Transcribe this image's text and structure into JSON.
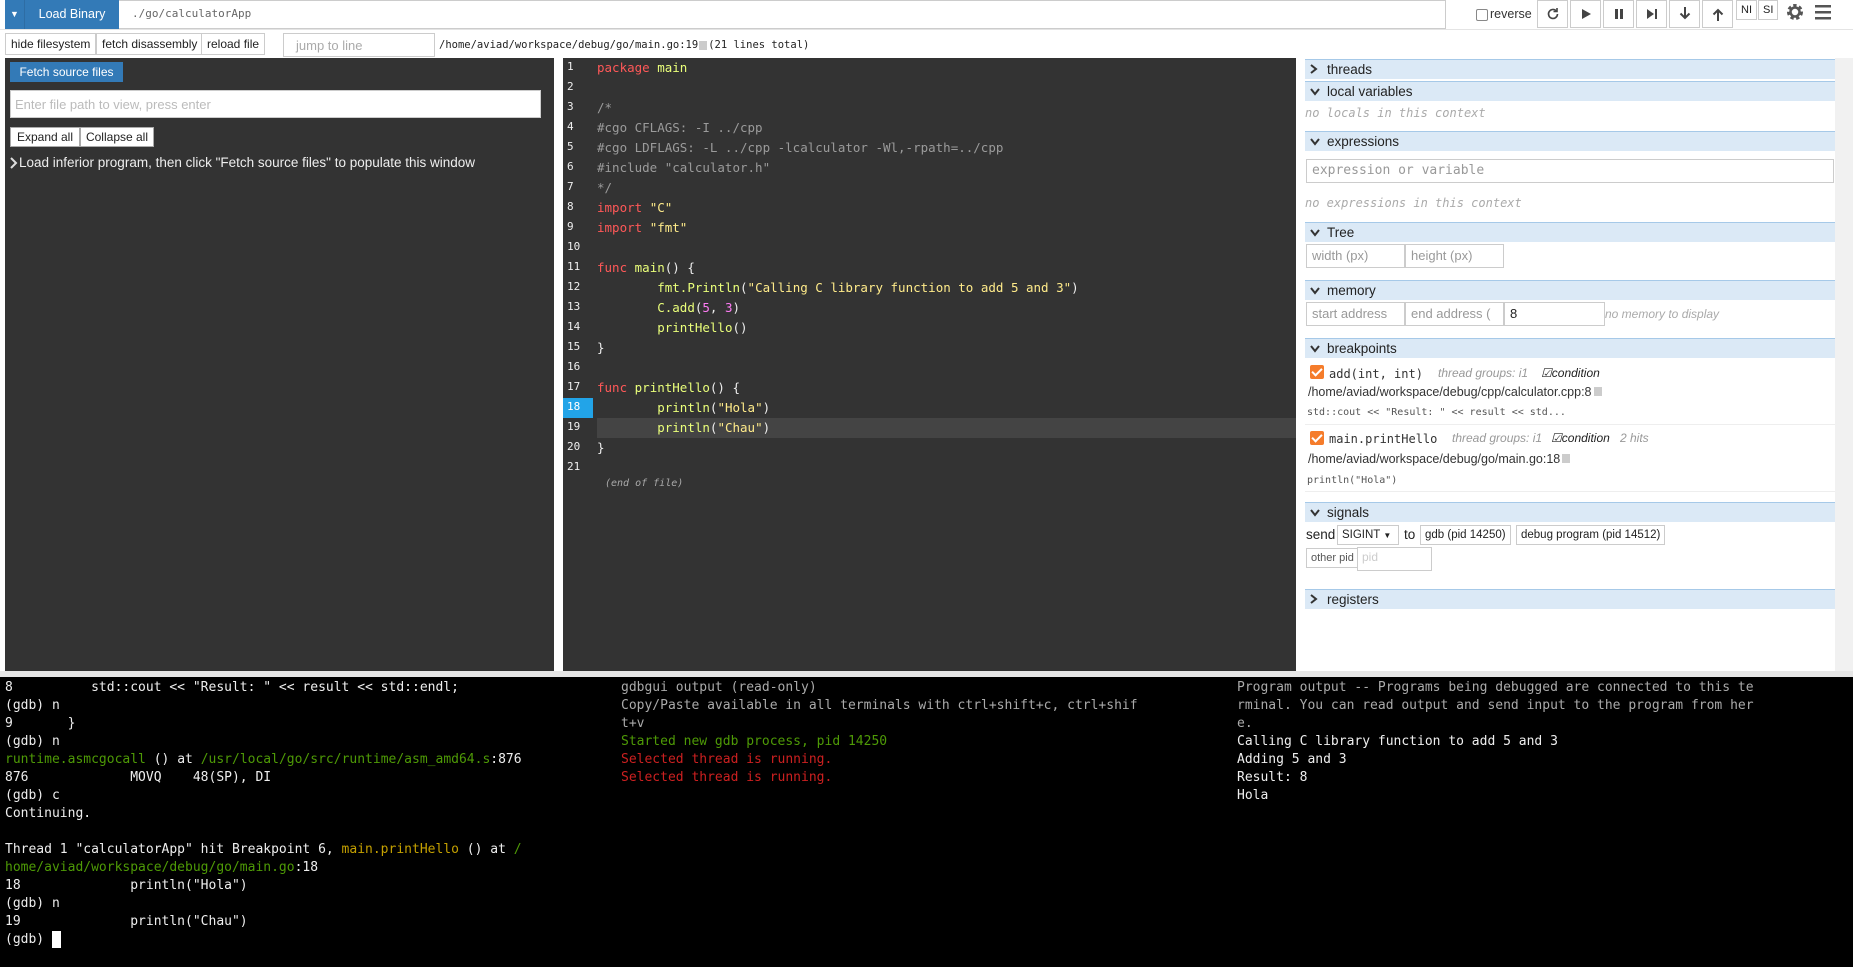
{
  "toolbar": {
    "load_binary_label": "Load Binary",
    "binary_path": "./go/calculatorApp",
    "reverse_label": "reverse",
    "ni_label": "NI",
    "si_label": "SI"
  },
  "subbar": {
    "hide_fs_label": "hide filesystem",
    "fetch_disasm_label": "fetch disassembly",
    "reload_label": "reload file",
    "jump_placeholder": "jump to line",
    "file_path": "/home/aviad/workspace/debug/go/main.go:19",
    "lines_total": "(21 lines total)"
  },
  "filesystem": {
    "fetch_label": "Fetch source files",
    "path_placeholder": "Enter file path to view, press enter",
    "expand_label": "Expand all",
    "collapse_label": "Collapse all",
    "message": "Load inferior program, then click \"Fetch source files\" to populate this window"
  },
  "source": {
    "current_line": 18,
    "highlight_line": 19,
    "eof_label": "(end of file)",
    "line_numbers": [
      "1",
      "2",
      "3",
      "4",
      "5",
      "6",
      "7",
      "8",
      "9",
      "10",
      "11",
      "12",
      "13",
      "14",
      "15",
      "16",
      "17",
      "18",
      "19",
      "20",
      "21"
    ]
  },
  "sidebar": {
    "threads_title": "threads",
    "locals_title": "local variables",
    "locals_empty": "no locals in this context",
    "expressions_title": "expressions",
    "expr_placeholder": "expression or variable",
    "expr_empty": "no expressions in this context",
    "tree_title": "Tree",
    "tree_width_ph": "width (px)",
    "tree_height_ph": "height (px)",
    "memory_title": "memory",
    "mem_start_ph": "start address",
    "mem_end_ph": "end address (",
    "mem_count": "8",
    "mem_empty": "no memory to display",
    "breakpoints_title": "breakpoints",
    "breakpoints": [
      {
        "fn": "add(int, int)",
        "meta": "thread groups: i1",
        "cond": "condition",
        "hits": "",
        "path": "/home/aviad/workspace/debug/cpp/calculator.cpp:8",
        "src": "std::cout << \"Result: \" << result << std..."
      },
      {
        "fn": "main.printHello",
        "meta": "thread groups: i1",
        "cond": "condition",
        "hits": "2 hits",
        "path": "/home/aviad/workspace/debug/go/main.go:18",
        "src": "println(\"Hola\")"
      }
    ],
    "signals_title": "signals",
    "send_label": "send",
    "signal_value": "SIGINT",
    "to_label": "to",
    "gdb_pid_label": "gdb (pid 14250)",
    "debug_pid_label": "debug program (pid 14512)",
    "other_pid_label": "other pid",
    "pid_placeholder": "pid",
    "registers_title": "registers"
  },
  "terminals": {
    "gdb": {
      "l1": "8          std::cout << \"Result: \" << result << std::endl;",
      "l2": "(gdb) n",
      "l3": "9       }",
      "l4": "(gdb) n",
      "l5_fn": "runtime.asmcgocall",
      "l5_mid": " () at ",
      "l5_path": "/usr/local/go/src/runtime/asm_amd64.s",
      "l5_line": ":876",
      "l6": "876             MOVQ    48(SP), DI",
      "l7": "(gdb) c",
      "l8": "Continuing.",
      "l10_a": "Thread 1 \"calculatorApp\" hit Breakpoint 6, ",
      "l10_fn": "main.printHello",
      "l10_b": " () at ",
      "l10_c": "/",
      "l11_path": "home/aviad/workspace/debug/go/main.go",
      "l11_line": ":18",
      "l12": "18              println(\"Hola\")",
      "l13": "(gdb) n",
      "l14": "19              println(\"Chau\")",
      "l15": "(gdb) "
    },
    "gdbgui": {
      "l1": "gdbgui output (read-only)",
      "l2": "Copy/Paste available in all terminals with ctrl+shift+c, ctrl+shif",
      "l3": "t+v",
      "l4": "Started new gdb process, pid 14250",
      "l5": "Selected thread is running.",
      "l6": "Selected thread is running."
    },
    "program": {
      "l1": "Program output -- Programs being debugged are connected to this te",
      "l2": "rminal. You can read output and send input to the program from her",
      "l3": "e.",
      "l4": "Calling C library function to add 5 and 3",
      "l5": "Adding 5 and 3",
      "l6": "Result: 8",
      "l7": "Hola"
    }
  },
  "colors": {
    "accent": "#337ab7",
    "current_line": "#22a4e8",
    "breakpoint": "#f57c2b"
  }
}
